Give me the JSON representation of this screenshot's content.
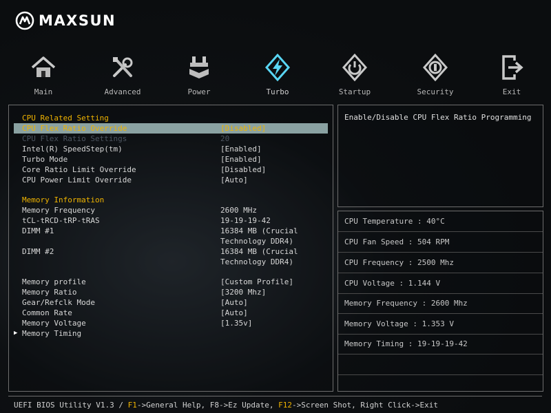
{
  "brand": {
    "name": "MAXSUN"
  },
  "colors": {
    "accent": "#f0b400",
    "selection": "#8aa2a2",
    "border": "#6e6e6e",
    "turbo_icon": "#59d6f4"
  },
  "tabs": [
    {
      "label": "Main",
      "icon": "home-icon"
    },
    {
      "label": "Advanced",
      "icon": "tools-icon"
    },
    {
      "label": "Power",
      "icon": "power-board-icon"
    },
    {
      "label": "Turbo",
      "icon": "lightning-icon",
      "active": true
    },
    {
      "label": "Startup",
      "icon": "power-button-icon"
    },
    {
      "label": "Security",
      "icon": "shield-icon"
    },
    {
      "label": "Exit",
      "icon": "exit-icon"
    }
  ],
  "settings": {
    "cpu_section": "CPU Related Setting",
    "cpu_flex_override": {
      "label": "CPU Flex Ratio Override",
      "value": "[Disabled]"
    },
    "cpu_flex_settings": {
      "label": "CPU Flex Ratio Settings",
      "value": "20"
    },
    "speedstep": {
      "label": "Intel(R) SpeedStep(tm)",
      "value": "[Enabled]"
    },
    "turbo_mode": {
      "label": "Turbo Mode",
      "value": "[Enabled]"
    },
    "core_ratio": {
      "label": "Core Ratio Limit Override",
      "value": "[Disabled]"
    },
    "power_limit": {
      "label": "CPU Power Limit Override",
      "value": "[Auto]"
    },
    "memory_section": "Memory Information",
    "mem_freq": {
      "label": "Memory Frequency",
      "value": "2600 MHz"
    },
    "timings": {
      "label": "tCL-tRCD-tRP-tRAS",
      "value": "19-19-19-42"
    },
    "dimm1": {
      "label": "DIMM #1",
      "value_line1": "16384 MB (Crucial",
      "value_line2": "Technology DDR4)"
    },
    "dimm2": {
      "label": "DIMM #2",
      "value_line1": "16384 MB (Crucial",
      "value_line2": "Technology DDR4)"
    },
    "mem_profile": {
      "label": "Memory profile",
      "value": "[Custom Profile]"
    },
    "mem_ratio": {
      "label": "Memory Ratio",
      "value": "[3200 Mhz]"
    },
    "gear": {
      "label": "Gear/Refclk Mode",
      "value": "[Auto]"
    },
    "common_rate": {
      "label": "Common Rate",
      "value": "[Auto]"
    },
    "mem_voltage": {
      "label": "Memory Voltage",
      "value": "[1.35v]"
    },
    "mem_timing": {
      "label": "Memory Timing"
    }
  },
  "help": {
    "text": "Enable/Disable CPU Flex Ratio Programming"
  },
  "status": [
    "CPU Temperature : 40°C",
    "CPU Fan Speed : 504 RPM",
    "CPU Frequency : 2500 Mhz",
    "CPU Voltage : 1.144 V",
    "Memory Frequency : 2600 Mhz",
    "Memory Voltage : 1.353 V",
    "Memory Timing : 19-19-19-42"
  ],
  "footer": {
    "utility": "UEFI BIOS Utility V1.3 /",
    "f1_key": "F1",
    "f1_text": "->General Help,",
    "f8_text": "F8->Ez Update,",
    "f12_key": "F12",
    "f12_text": "->Screen Shot, Right Click->Exit"
  }
}
